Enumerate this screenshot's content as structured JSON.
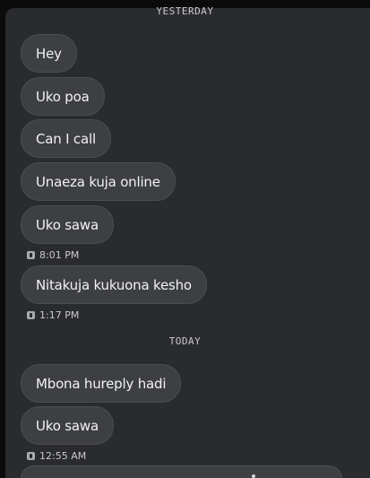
{
  "conversation": {
    "yesterday_label": "YESTERDAY",
    "today_label": "TODAY",
    "messages": [
      {
        "text": "Hey"
      },
      {
        "text": "Uko poa"
      },
      {
        "text": "Can I call"
      },
      {
        "text": "Unaeza kuja online"
      },
      {
        "text": "Uko sawa"
      },
      {
        "text": "Nitakuja kukuona kesho"
      },
      {
        "text": "Mbona hureply hadi"
      },
      {
        "text": "Uko sawa"
      }
    ],
    "timestamps": [
      {
        "time": "8:01 PM",
        "sim_icon": "sim-1-icon"
      },
      {
        "time": "1:17 PM",
        "sim_icon": "sim-1-icon"
      },
      {
        "time": "12:55 AM",
        "sim_icon": "sim-1-icon"
      }
    ]
  },
  "colors": {
    "background": "#0b0b0c",
    "panel": "#2a2b2e",
    "bubble": "#3d3f43",
    "bubble_text": "#f2f2f4",
    "meta_text": "#c9c9cd"
  }
}
